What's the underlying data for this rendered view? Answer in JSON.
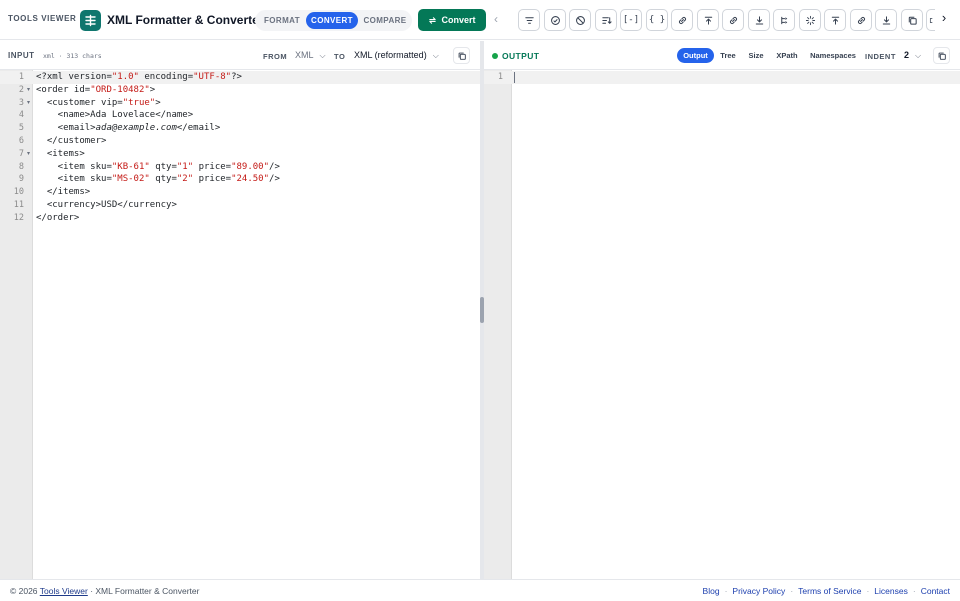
{
  "header": {
    "brand": "TOOLS VIEWER",
    "app_title": "XML Formatter & Converter",
    "modes": [
      "FORMAT",
      "CONVERT",
      "COMPARE"
    ],
    "active_mode": "CONVERT",
    "convert_label": "Convert",
    "accent_color": "#047857",
    "mode_active_color": "#2563eb",
    "nav_prev_icon": "chevron-left-icon",
    "nav_next_icon": "chevron-right-icon",
    "toolbar_icons": [
      "filter-icon",
      "check-circle-icon",
      "block-icon",
      "sort-icon",
      "brackets-icon",
      "braces-icon",
      "link-icon",
      "upload-icon",
      "link-icon",
      "download-icon",
      "tree-icon",
      "sparkle-icon",
      "upload-icon",
      "link-icon",
      "download-icon",
      "copy-icon",
      "partial-icon"
    ],
    "toolbar_text": {
      "braces": "{ }",
      "brackets": "[-]"
    }
  },
  "input": {
    "label": "INPUT",
    "meta": "xml · 313 chars",
    "from_label": "FROM",
    "from_value": "XML",
    "to_label": "TO",
    "to_value": "XML (reformatted)",
    "line_numbers": [
      "1",
      "2",
      "3",
      "4",
      "5",
      "6",
      "7",
      "8",
      "9",
      "10",
      "11",
      "12"
    ],
    "fold_lines": [
      "2",
      "3",
      "7"
    ],
    "lines": [
      "<?xml version=\"1.0\" encoding=\"UTF-8\"?>",
      "<order id=\"ORD-10482\">",
      "  <customer vip=\"true\">",
      "    <name>Ada Lovelace</name>",
      "    <email>ada@example.com</email>",
      "  </customer>",
      "  <items>",
      "    <item sku=\"KB-61\" qty=\"1\" price=\"89.00\"/>",
      "    <item sku=\"MS-02\" qty=\"2\" price=\"24.50\"/>",
      "  </items>",
      "  <currency>USD</currency>",
      "</order>"
    ]
  },
  "output": {
    "label": "OUTPUT",
    "status_color": "#16a34a",
    "tabs": [
      "Output",
      "Tree",
      "Size",
      "XPath",
      "Namespaces"
    ],
    "active_tab": "Output",
    "indent_label": "INDENT",
    "indent_value": "2",
    "line_numbers": [
      "1"
    ]
  },
  "footer": {
    "copyright": "© 2026",
    "site_link": "Tools Viewer",
    "suffix": "· XML Formatter & Converter",
    "links": [
      "Blog",
      "Privacy Policy",
      "Terms of Service",
      "Licenses",
      "Contact"
    ]
  }
}
